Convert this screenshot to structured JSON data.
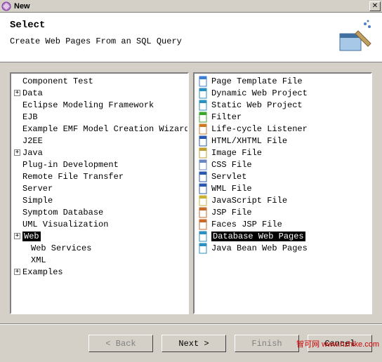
{
  "window": {
    "title": "New"
  },
  "header": {
    "heading": "Select",
    "subtitle": "Create Web Pages From an SQL Query"
  },
  "left_tree": {
    "items": [
      {
        "label": "Component Test",
        "expander": ""
      },
      {
        "label": "Data",
        "expander": "+"
      },
      {
        "label": "Eclipse Modeling Framework",
        "expander": ""
      },
      {
        "label": "EJB",
        "expander": ""
      },
      {
        "label": "Example EMF Model Creation Wizards",
        "expander": ""
      },
      {
        "label": "J2EE",
        "expander": ""
      },
      {
        "label": "Java",
        "expander": "+"
      },
      {
        "label": "Plug-in Development",
        "expander": ""
      },
      {
        "label": "Remote File Transfer",
        "expander": ""
      },
      {
        "label": "Server",
        "expander": ""
      },
      {
        "label": "Simple",
        "expander": ""
      },
      {
        "label": "Symptom Database",
        "expander": ""
      },
      {
        "label": "UML Visualization",
        "expander": ""
      },
      {
        "label": "Web",
        "expander": "+",
        "selected": true
      },
      {
        "label": "Web Services",
        "expander": "",
        "indent": 1
      },
      {
        "label": "XML",
        "expander": "",
        "indent": 1
      },
      {
        "label": "Examples",
        "expander": "+"
      }
    ]
  },
  "right_list": {
    "items": [
      {
        "label": "Page Template File",
        "color": "#3b7ed8"
      },
      {
        "label": "Dynamic Web Project",
        "color": "#2a90c0"
      },
      {
        "label": "Static Web Project",
        "color": "#2a90c0"
      },
      {
        "label": "Filter",
        "color": "#3aa62a"
      },
      {
        "label": "Life-cycle Listener",
        "color": "#cc7a2a"
      },
      {
        "label": "HTML/XHTML File",
        "color": "#2a58b0"
      },
      {
        "label": "Image File",
        "color": "#c0a030"
      },
      {
        "label": "CSS File",
        "color": "#6a88c0"
      },
      {
        "label": "Servlet",
        "color": "#2a58b0"
      },
      {
        "label": "WML File",
        "color": "#2a58b0"
      },
      {
        "label": "JavaScript File",
        "color": "#c8b030"
      },
      {
        "label": "JSP File",
        "color": "#c86a2a"
      },
      {
        "label": "Faces JSP File",
        "color": "#c86a2a"
      },
      {
        "label": "Database Web Pages",
        "color": "#2a90c0",
        "selected": true
      },
      {
        "label": "Java Bean Web Pages",
        "color": "#2a90c0"
      }
    ]
  },
  "buttons": {
    "back": "< Back",
    "next": "Next >",
    "finish": "Finish",
    "cancel": "Cancel"
  },
  "watermark": {
    "cn": "智可网",
    "url": "www.hzhike.com"
  }
}
